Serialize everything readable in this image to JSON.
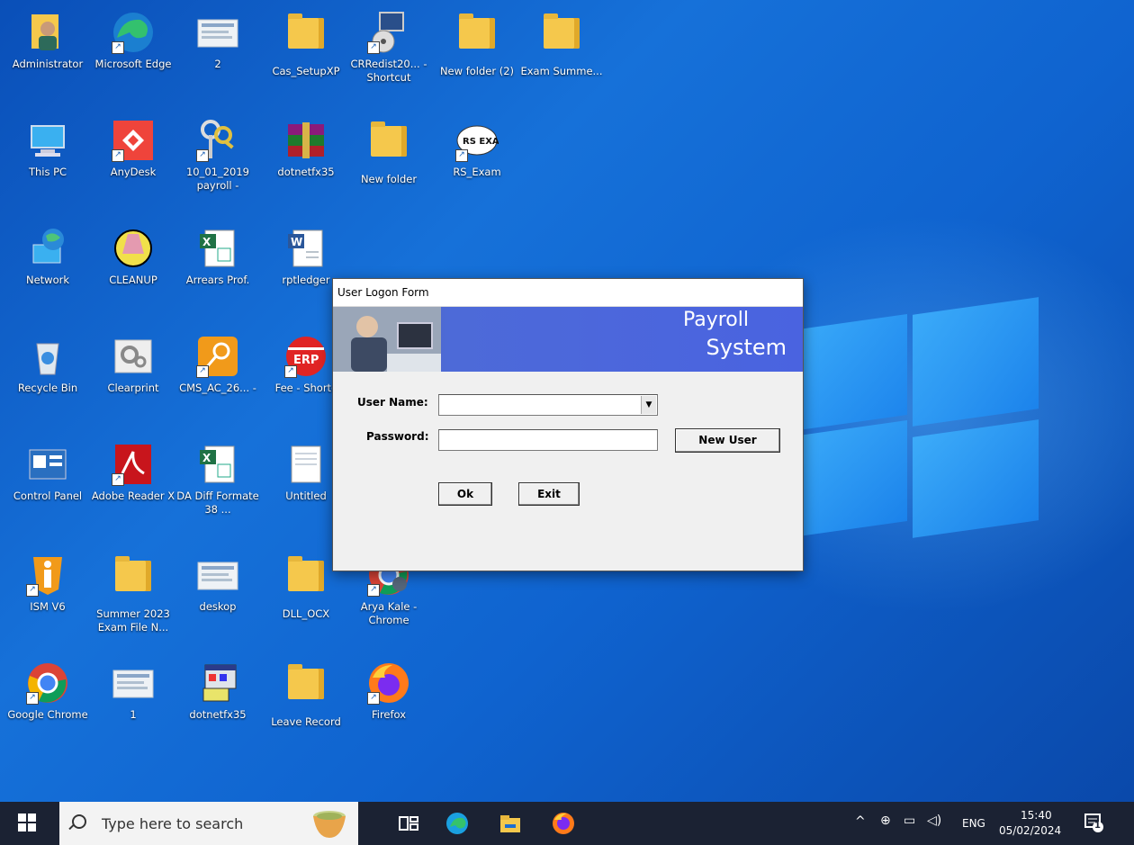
{
  "desktop": {
    "icons": [
      {
        "label": "Administrator",
        "kind": "user"
      },
      {
        "label": "Microsoft Edge",
        "kind": "edge"
      },
      {
        "label": "2",
        "kind": "image"
      },
      {
        "label": "Cas_SetupXP",
        "kind": "folder"
      },
      {
        "label": "CRRedist20... - Shortcut",
        "kind": "installer"
      },
      {
        "label": "New folder (2)",
        "kind": "folder"
      },
      {
        "label": "Exam Summe...",
        "kind": "folder"
      },
      {
        "label": "This PC",
        "kind": "pc"
      },
      {
        "label": "AnyDesk",
        "kind": "anydesk"
      },
      {
        "label": "10_01_2019 payroll -",
        "kind": "keys"
      },
      {
        "label": "dotnetfx35",
        "kind": "winrar"
      },
      {
        "label": "New folder",
        "kind": "folder"
      },
      {
        "label": "RS_Exam",
        "kind": "rsexam"
      },
      {
        "label": "Network",
        "kind": "network"
      },
      {
        "label": "CLEANUP",
        "kind": "cleanup"
      },
      {
        "label": "Arrears Prof.",
        "kind": "excel"
      },
      {
        "label": "rptledger",
        "kind": "word"
      },
      {
        "label": "Recycle Bin",
        "kind": "recycle"
      },
      {
        "label": "Clearprint",
        "kind": "gear"
      },
      {
        "label": "CMS_AC_26... -",
        "kind": "key-orange"
      },
      {
        "label": "Fee - Shortc",
        "kind": "erp"
      },
      {
        "label": "Control Panel",
        "kind": "controlpanel"
      },
      {
        "label": "Adobe Reader X",
        "kind": "adobe"
      },
      {
        "label": "DA Diff Formate 38 ...",
        "kind": "excel"
      },
      {
        "label": "Untitled",
        "kind": "doc"
      },
      {
        "label": "ISM V6",
        "kind": "ism"
      },
      {
        "label": "Summer 2023 Exam File N...",
        "kind": "folder"
      },
      {
        "label": "deskop",
        "kind": "image"
      },
      {
        "label": "DLL_OCX",
        "kind": "folder"
      },
      {
        "label": "Arya Kale - Chrome",
        "kind": "chrome-user"
      },
      {
        "label": "Google Chrome",
        "kind": "chrome"
      },
      {
        "label": "1",
        "kind": "image"
      },
      {
        "label": "dotnetfx35",
        "kind": "setup"
      },
      {
        "label": "Leave Record",
        "kind": "folder"
      },
      {
        "label": "Firefox",
        "kind": "firefox"
      }
    ],
    "erp_text": "ERP"
  },
  "dialog": {
    "title": "User Logon Form",
    "banner_line1": "Payroll",
    "banner_line2": "System",
    "username_label": "User Name:",
    "username_value": "",
    "password_label": "Password:",
    "password_value": "",
    "new_user_label": "New User",
    "ok_label": "Ok",
    "exit_label": "Exit"
  },
  "taskbar": {
    "search_placeholder": "Type here to search",
    "language": "ENG",
    "time": "15:40",
    "date": "05/02/2024",
    "notification_count": "1"
  },
  "colors": {
    "desktop_bg": "#0f63cf",
    "taskbar_bg": "#1b2233",
    "banner_bg": "#4a63e0"
  }
}
